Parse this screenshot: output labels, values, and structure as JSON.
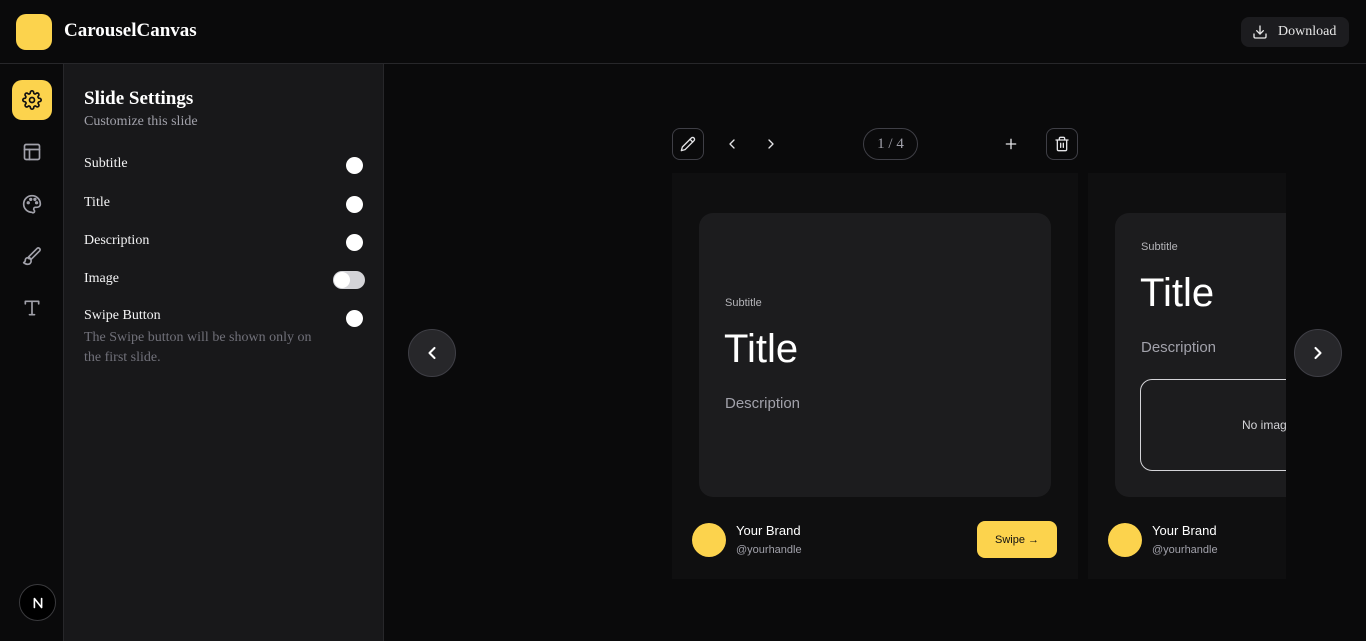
{
  "header": {
    "app_title": "CarouselCanvas",
    "download_label": "Download",
    "download_icon": "download-icon"
  },
  "rail": {
    "items": [
      {
        "name": "settings",
        "icon": "gear-icon",
        "active": true
      },
      {
        "name": "layout",
        "icon": "layout-icon",
        "active": false
      },
      {
        "name": "palette",
        "icon": "palette-icon",
        "active": false
      },
      {
        "name": "brush",
        "icon": "brush-icon",
        "active": false
      },
      {
        "name": "typography",
        "icon": "text-icon",
        "active": false
      }
    ],
    "user_avatar_letter": "N"
  },
  "panel": {
    "title": "Slide Settings",
    "subtitle": "Customize this slide",
    "settings": [
      {
        "label": "Subtitle",
        "enabled": true
      },
      {
        "label": "Title",
        "enabled": true
      },
      {
        "label": "Description",
        "enabled": true
      },
      {
        "label": "Image",
        "enabled": false
      },
      {
        "label": "Swipe Button",
        "enabled": true,
        "note": "The Swipe button will be shown only on the first slide."
      }
    ]
  },
  "toolbar": {
    "page_indicator": "1 / 4",
    "icons": [
      "pencil-icon",
      "chevron-left-icon",
      "chevron-right-icon",
      "plus-icon",
      "trash-icon"
    ]
  },
  "slides": [
    {
      "subtitle": "Subtitle",
      "title": "Title",
      "description": "Description",
      "brand_name": "Your Brand",
      "brand_handle": "@yourhandle",
      "swipe_label": "Swipe →"
    },
    {
      "subtitle": "Subtitle",
      "title": "Title",
      "description": "Description",
      "image_placeholder": "No image",
      "brand_name": "Your Brand",
      "brand_handle": "@yourhandle"
    }
  ],
  "colors": {
    "accent": "#fcd34d",
    "background": "#0a0a0b",
    "panel": "#18181a",
    "card": "#1c1c1e"
  }
}
